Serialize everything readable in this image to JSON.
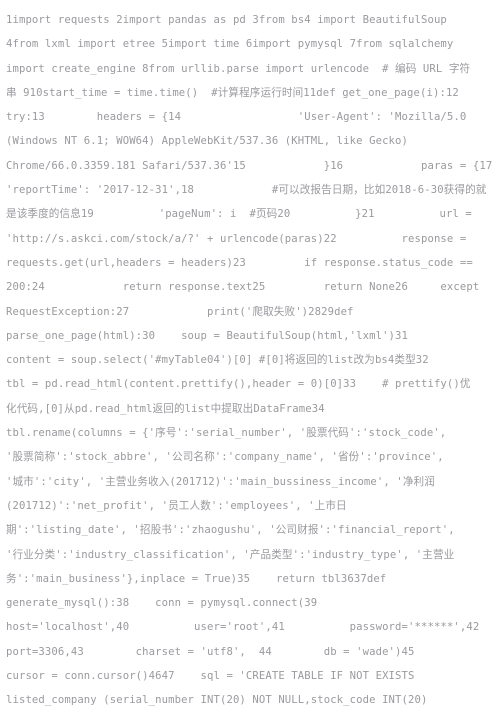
{
  "document": {
    "kind": "code-snippet",
    "language": "python",
    "background_color": "#ffffff",
    "text_color": "#9a9a9f",
    "line_count": 22,
    "lines": [
      "1import requests 2import pandas as pd 3from bs4 import BeautifulSoup",
      "4from lxml import etree 5import time 6import pymysql 7from sqlalchemy",
      "import create_engine 8from urllib.parse import urlencode  # 编码 URL 字符",
      "串 910start_time = time.time()  #计算程序运行时间11def get_one_page(i):12",
      "try:13        headers = {14                  'User-Agent': 'Mozilla/5.0",
      "(Windows NT 6.1; WOW64) AppleWebKit/537.36 (KHTML, like Gecko)",
      "Chrome/66.0.3359.181 Safari/537.36'15            }16            paras = {17",
      "'reportTime': '2017-12-31',18            #可以改报告日期，比如2018-6-30获得的就",
      "是该季度的信息19          'pageNum': i  #页码20          }21          url =",
      "'http://s.askci.com/stock/a/?' + urlencode(paras)22          response =",
      "requests.get(url,headers = headers)23         if response.status_code ==",
      "200:24            return response.text25         return None26     except",
      "RequestException:27            print('爬取失败')2829def",
      "parse_one_page(html):30    soup = BeautifulSoup(html,'lxml')31",
      "content = soup.select('#myTable04')[0] #[0]将返回的list改为bs4类型32",
      "tbl = pd.read_html(content.prettify(),header = 0)[0]33    # prettify()优",
      "化代码,[0]从pd.read_html返回的list中提取出DataFrame34",
      "tbl.rename(columns = {'序号':'serial_number', '股票代码':'stock_code',",
      "'股票简称':'stock_abbre', '公司名称':'company_name', '省份':'province',",
      "'城市':'city', '主营业务收入(201712)':'main_bussiness_income', '净利润",
      "(201712)':'net_profit', '员工人数':'employees', '上市日",
      "期':'listing_date', '招股书':'zhaogushu', '公司财报':'financial_report',",
      "'行业分类':'industry_classification', '产品类型':'industry_type', '主营业",
      "务':'main_business'},inplace = True)35    return tbl3637def",
      "generate_mysql():38    conn = pymysql.connect(39",
      "host='localhost',40          user='root',41          password='******',42",
      "port=3306,43        charset = 'utf8',  44        db = 'wade')45",
      "cursor = conn.cursor()4647    sql = 'CREATE TABLE IF NOT EXISTS",
      "listed_company (serial_number INT(20) NOT NULL,stock_code INT(20)"
    ]
  }
}
